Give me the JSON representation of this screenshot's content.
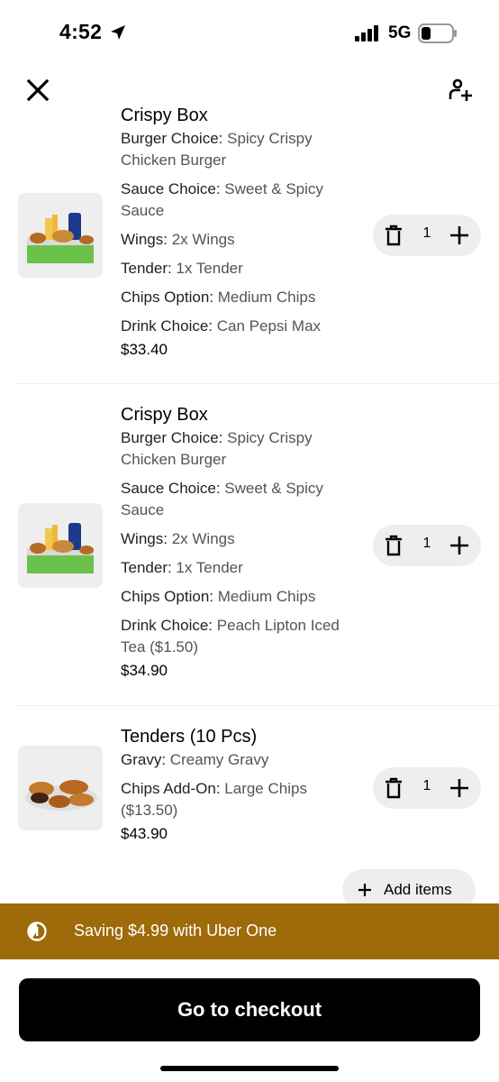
{
  "status_bar": {
    "time": "4:52",
    "network": "5G"
  },
  "header": {
    "close_icon": "close-icon",
    "add_person_icon": "add-person-icon"
  },
  "cart": {
    "items": [
      {
        "title": "Crispy Box",
        "options": [
          {
            "key": "Burger Choice:",
            "value": " Spicy Crispy Chicken Burger"
          },
          {
            "key": "Sauce Choice:",
            "value": " Sweet & Spicy Sauce"
          },
          {
            "key": "Wings:",
            "value": " 2x Wings"
          },
          {
            "key": "Tender:",
            "value": " 1x Tender"
          },
          {
            "key": "Chips Option:",
            "value": " Medium Chips"
          },
          {
            "key": "Drink Choice:",
            "value": " Can Pepsi Max"
          }
        ],
        "price": "$33.40",
        "quantity": "1"
      },
      {
        "title": "Crispy Box",
        "options": [
          {
            "key": "Burger Choice:",
            "value": " Spicy Crispy Chicken Burger"
          },
          {
            "key": "Sauce Choice:",
            "value": " Sweet & Spicy Sauce"
          },
          {
            "key": "Wings:",
            "value": " 2x Wings"
          },
          {
            "key": "Tender:",
            "value": " 1x Tender"
          },
          {
            "key": "Chips Option:",
            "value": " Medium Chips"
          },
          {
            "key": "Drink Choice:",
            "value": " Peach Lipton Iced Tea ($1.50)"
          }
        ],
        "price": "$34.90",
        "quantity": "1"
      },
      {
        "title": "Tenders (10 Pcs)",
        "options": [
          {
            "key": "Gravy:",
            "value": " Creamy Gravy"
          },
          {
            "key": "Chips Add-On:",
            "value": " Large Chips ($13.50)"
          }
        ],
        "price": "$43.90",
        "quantity": "1"
      }
    ],
    "add_items_label": "Add items"
  },
  "uber_one": {
    "text": "Saving $4.99 with Uber One"
  },
  "checkout": {
    "label": "Go to checkout"
  },
  "colors": {
    "banner": "#9e6a0a",
    "button": "#000000",
    "stepper": "#eeeeee"
  }
}
